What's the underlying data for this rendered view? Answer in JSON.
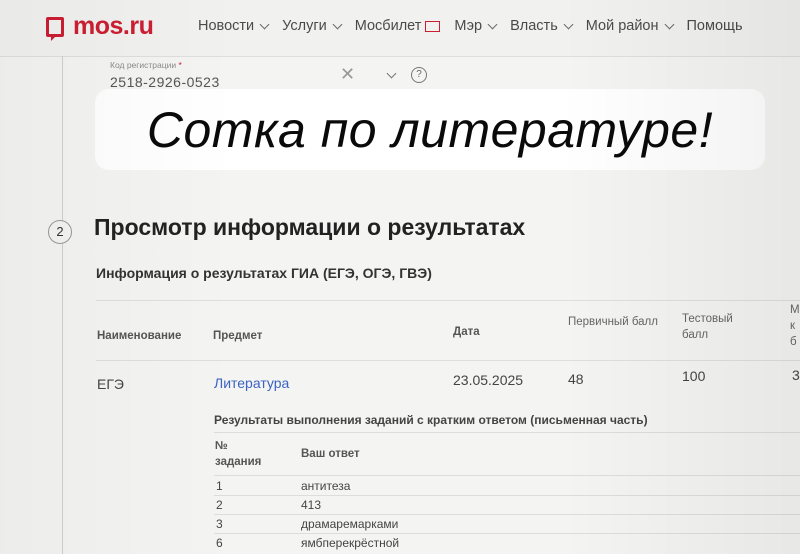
{
  "header": {
    "logo_text": "mos.ru",
    "nav": [
      {
        "label": "Новости",
        "has_chevron": true
      },
      {
        "label": "Услуги",
        "has_chevron": true
      },
      {
        "label": "Мосбилет",
        "has_ticket_icon": true
      },
      {
        "label": "Мэр",
        "has_chevron": true
      },
      {
        "label": "Власть",
        "has_chevron": true
      },
      {
        "label": "Мой район",
        "has_chevron": true
      },
      {
        "label": "Помощь",
        "has_chevron": false
      }
    ],
    "brand_color": "#cc1e33"
  },
  "reg_field": {
    "label": "Код регистрации",
    "required_mark": "*",
    "value": "2518-2926-0523",
    "clear_icon": "close-icon",
    "dropdown_icon": "chevron-down-icon",
    "help_icon": "help-icon"
  },
  "banner": {
    "text": "Сотка по литературе!"
  },
  "step": {
    "number": "2",
    "title": "Просмотр информации о результатах",
    "subtitle": "Информация о результатах ГИА (ЕГЭ, ОГЭ, ГВЭ)"
  },
  "results_table": {
    "headers": {
      "name": "Наименование",
      "subject": "Предмет",
      "date": "Дата",
      "primary": "Первичный балл",
      "test": "Тестовый балл",
      "extra": "М к б"
    },
    "row": {
      "name": "ЕГЭ",
      "subject": "Литература",
      "date": "23.05.2025",
      "primary": "48",
      "test": "100",
      "extra": "3"
    },
    "link_color": "#3b63c4"
  },
  "short_answers": {
    "title": "Результаты выполнения заданий с кратким ответом (письменная часть)",
    "header_no": "№ задания",
    "header_answer": "Ваш ответ",
    "rows": [
      {
        "no": "1",
        "answer": "антитеза"
      },
      {
        "no": "2",
        "answer": "413"
      },
      {
        "no": "3",
        "answer": "драмаремарками"
      },
      {
        "no": "6",
        "answer": "ямбперекрёстной"
      }
    ]
  }
}
